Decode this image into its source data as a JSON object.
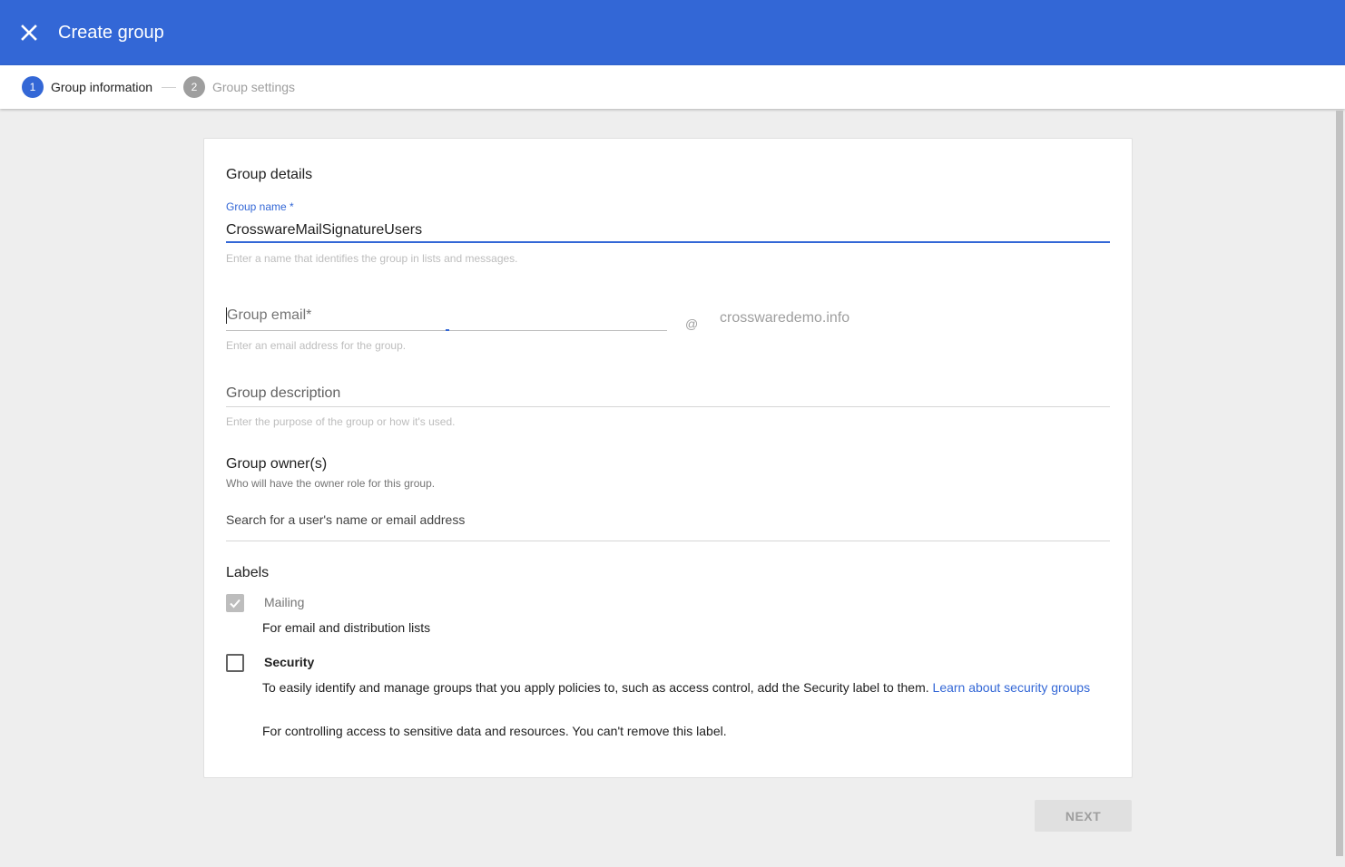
{
  "header": {
    "title": "Create group",
    "close_icon": "close-icon",
    "bg_color": "#3367d6"
  },
  "stepper": {
    "steps": [
      {
        "number": "1",
        "label": "Group information",
        "state": "active"
      },
      {
        "number": "2",
        "label": "Group settings",
        "state": "inactive"
      }
    ]
  },
  "form": {
    "section_title": "Group details",
    "group_name": {
      "label": "Group name *",
      "value": "CrosswareMailSignatureUsers",
      "hint": "Enter a name that identifies the group in lists and messages."
    },
    "group_email": {
      "placeholder": "Group email*",
      "value": "",
      "hint": "Enter an email address for the group.",
      "at": "@",
      "domain": "crosswaredemo.info"
    },
    "group_description": {
      "placeholder": "Group description",
      "value": "",
      "hint": "Enter the purpose of the group or how it's used."
    },
    "owners": {
      "title": "Group owner(s)",
      "subtitle": "Who will have the owner role for this group.",
      "placeholder": "Search for a user's name or email address"
    },
    "labels": {
      "title": "Labels",
      "mailing": {
        "name": "Mailing",
        "description": "For email and distribution lists",
        "checked": true,
        "disabled": true
      },
      "security": {
        "name": "Security",
        "description": "To easily identify and manage groups that you apply policies to, such as access control, add the Security label to them.",
        "link_text": "Learn about security groups",
        "note": "For controlling access to sensitive data and resources. You can't remove this label.",
        "checked": false
      }
    }
  },
  "footer": {
    "next_label": "NEXT",
    "next_disabled": true
  }
}
